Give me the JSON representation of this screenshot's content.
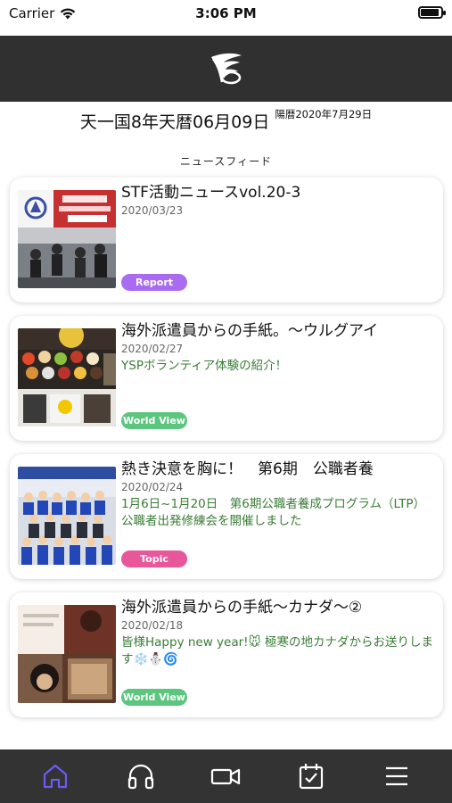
{
  "status_bar": {
    "carrier": "Carrier",
    "time": "3:06 PM"
  },
  "header": {
    "logo": "app-logo"
  },
  "date": {
    "main": "天一国8年天暦06月09日",
    "sub": "陽暦2020年7月29日"
  },
  "feed": {
    "title": "ニュースフィード",
    "items": [
      {
        "title": "STF活動ニュースvol.20-3",
        "date": "2020/03/23",
        "excerpt": "",
        "tag": "Report",
        "tag_color": "#a96cf0"
      },
      {
        "title": "海外派遣員からの手紙。〜ウルグアイ",
        "date": "2020/02/27",
        "excerpt": "YSPボランティア体験の紹介！",
        "tag": "World View",
        "tag_color": "#5cc57e"
      },
      {
        "title": "熱き決意を胸に！　第6期　公職者養",
        "date": "2020/02/24",
        "excerpt": "1月6日~1月20日　第6期公職者養成プログラム（LTP）公職者出発修練会を開催しました",
        "tag": "Topic",
        "tag_color": "#e8579a"
      },
      {
        "title": "海外派遣員からの手紙〜カナダ〜②",
        "date": "2020/02/18",
        "excerpt": "皆様Happy new year!🐭 極寒の地カナダからお送りします❄️⛄🌀",
        "tag": "World View",
        "tag_color": "#5cc57e"
      }
    ]
  },
  "bottom_nav": {
    "items": [
      {
        "icon": "home-icon",
        "active": true,
        "color": "#6b5cf0"
      },
      {
        "icon": "headphones-icon",
        "active": false
      },
      {
        "icon": "video-icon",
        "active": false
      },
      {
        "icon": "calendar-check-icon",
        "active": false
      },
      {
        "icon": "menu-icon",
        "active": false
      }
    ]
  }
}
